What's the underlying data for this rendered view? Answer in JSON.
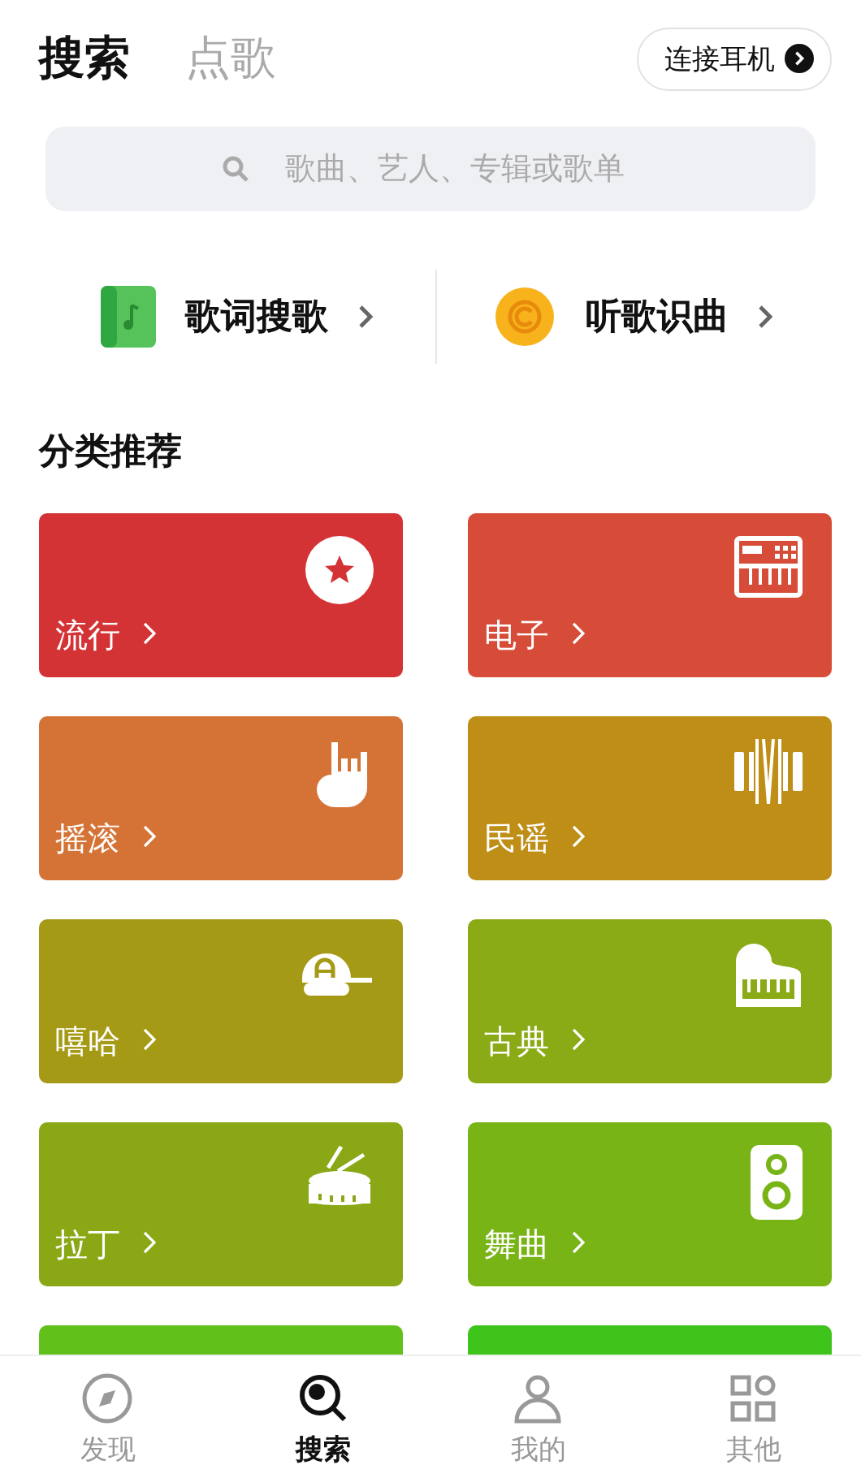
{
  "header_tabs": [
    {
      "label": "搜索",
      "selected": true
    },
    {
      "label": "点歌",
      "selected": false
    }
  ],
  "headphone_button": {
    "label": "连接耳机"
  },
  "search": {
    "placeholder": "歌曲、艺人、专辑或歌单"
  },
  "shortcuts": [
    {
      "label": "歌词搜歌"
    },
    {
      "label": "听歌识曲"
    }
  ],
  "section_title": "分类推荐",
  "categories": [
    {
      "label": "流行",
      "color": "#d43336"
    },
    {
      "label": "电子",
      "color": "#d64c38"
    },
    {
      "label": "摇滚",
      "color": "#d57336"
    },
    {
      "label": "民谣",
      "color": "#bf8e17"
    },
    {
      "label": "嘻哈",
      "color": "#a59a15"
    },
    {
      "label": "古典",
      "color": "#8aaa16"
    },
    {
      "label": "拉丁",
      "color": "#8aa816"
    },
    {
      "label": "舞曲",
      "color": "#79b416"
    },
    {
      "color": "#62c01a"
    },
    {
      "color": "#3ec41a"
    }
  ],
  "bottom_tabs": [
    {
      "label": "发现",
      "selected": false
    },
    {
      "label": "搜索",
      "selected": true
    },
    {
      "label": "我的",
      "selected": false
    },
    {
      "label": "其他",
      "selected": false
    }
  ]
}
